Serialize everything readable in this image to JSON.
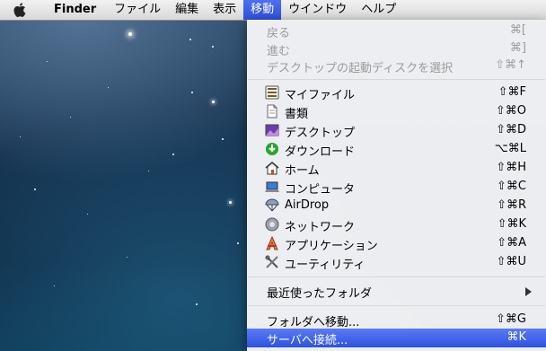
{
  "menubar": {
    "app_name": "Finder",
    "items": [
      "ファイル",
      "編集",
      "表示",
      "移動",
      "ウインドウ",
      "ヘルプ"
    ]
  },
  "go_menu": {
    "nav": [
      {
        "label": "戻る",
        "shortcut": "⌘[",
        "enabled": false
      },
      {
        "label": "進む",
        "shortcut": "⌘]",
        "enabled": false
      },
      {
        "label": "デスクトップの起動ディスクを選択",
        "shortcut": "⇧⌘↑",
        "enabled": false
      }
    ],
    "places": [
      {
        "label": "マイファイル",
        "shortcut": "⇧⌘F",
        "icon": "all-my-files-icon"
      },
      {
        "label": "書類",
        "shortcut": "⇧⌘O",
        "icon": "documents-icon"
      },
      {
        "label": "デスクトップ",
        "shortcut": "⇧⌘D",
        "icon": "desktop-icon"
      },
      {
        "label": "ダウンロード",
        "shortcut": "⌥⌘L",
        "icon": "downloads-icon"
      },
      {
        "label": "ホーム",
        "shortcut": "⇧⌘H",
        "icon": "home-icon"
      },
      {
        "label": "コンピュータ",
        "shortcut": "⇧⌘C",
        "icon": "computer-icon"
      },
      {
        "label": "AirDrop",
        "shortcut": "⇧⌘R",
        "icon": "airdrop-icon"
      },
      {
        "label": "ネットワーク",
        "shortcut": "⇧⌘K",
        "icon": "network-icon"
      },
      {
        "label": "アプリケーション",
        "shortcut": "⇧⌘A",
        "icon": "applications-icon"
      },
      {
        "label": "ユーティリティ",
        "shortcut": "⇧⌘U",
        "icon": "utilities-icon"
      }
    ],
    "recent": {
      "label": "最近使ったフォルダ"
    },
    "goto_folder": {
      "label": "フォルダへ移動...",
      "shortcut": "⇧⌘G"
    },
    "connect_server": {
      "label": "サーバへ接続...",
      "shortcut": "⌘K"
    }
  },
  "colors": {
    "selection": "#2e52e0",
    "disabled_text": "#9b9b9b"
  }
}
